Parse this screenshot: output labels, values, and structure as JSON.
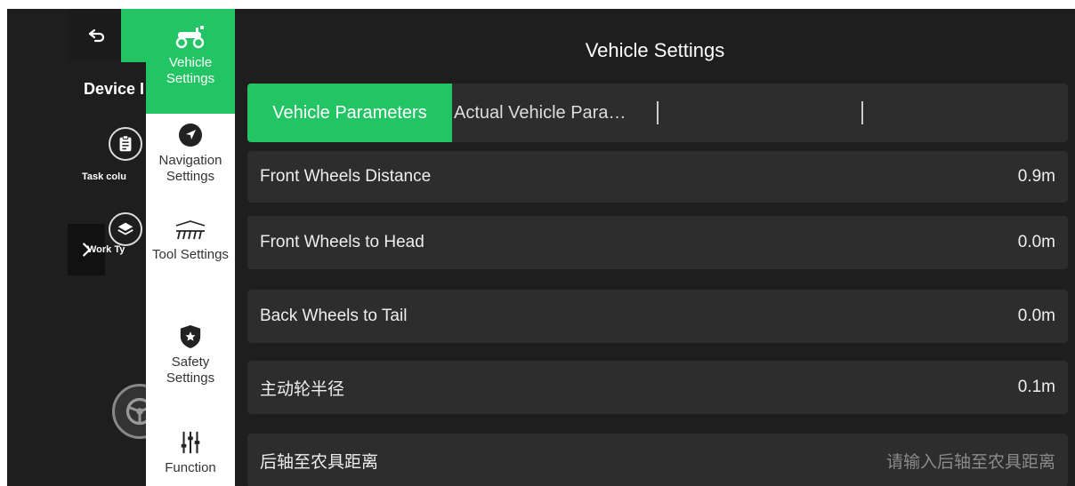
{
  "header": {
    "title": "Vehicle Settings"
  },
  "left_panel": {
    "device_title": "Device I",
    "task_label": "Task colu",
    "work_label": "Work Ty"
  },
  "menu": {
    "items": [
      {
        "id": "vehicle",
        "label": "Vehicle Settings",
        "icon": "tractor-icon",
        "active": true
      },
      {
        "id": "navigation",
        "label": "Navigation Settings",
        "icon": "navigation-arrow-icon",
        "active": false
      },
      {
        "id": "tool",
        "label": "Tool Settings",
        "icon": "implement-tool-icon",
        "active": false
      },
      {
        "id": "safety",
        "label": "Safety Settings",
        "icon": "shield-star-icon",
        "active": false
      },
      {
        "id": "function",
        "label": "Function",
        "icon": "sliders-icon",
        "active": false
      }
    ]
  },
  "tabs": [
    {
      "label": "Vehicle Parameters",
      "active": true
    },
    {
      "label": "Actual Vehicle Para…",
      "active": false
    }
  ],
  "rows": [
    {
      "label": "Front Wheels Distance",
      "value": "0.9m"
    },
    {
      "label": "Front Wheels to Head",
      "value": "0.0m"
    },
    {
      "label": "Back Wheels to Tail",
      "value": "0.0m"
    },
    {
      "label": "主动轮半径",
      "value": "0.1m"
    },
    {
      "label": "后轴至农具距离",
      "placeholder": "请输入后轴至农具距离"
    }
  ],
  "colors": {
    "accent": "#23c464",
    "background": "#1e1e1e",
    "row": "#2d2d2d"
  }
}
